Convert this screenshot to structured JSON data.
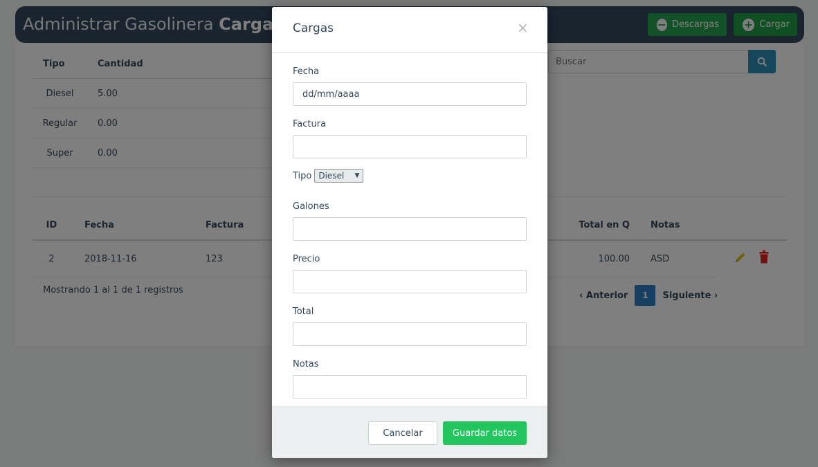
{
  "header": {
    "title_prefix": "Administrar Gasolinera",
    "title_bold": "Cargas",
    "btn_descargas": "Descargas",
    "btn_cargar": "Cargar",
    "color": "#34495e"
  },
  "summary": {
    "headers": [
      "Tipo",
      "Cantidad"
    ],
    "rows": [
      {
        "tipo": "Diesel",
        "cantidad": "5.00"
      },
      {
        "tipo": "Regular",
        "cantidad": "0.00"
      },
      {
        "tipo": "Super",
        "cantidad": "0.00"
      }
    ]
  },
  "search": {
    "placeholder": "Buscar"
  },
  "table": {
    "headers": {
      "id": "ID",
      "fecha": "Fecha",
      "factura": "Factura",
      "total": "Total en Q",
      "notas": "Notas"
    },
    "rows": [
      {
        "id": "2",
        "fecha": "2018-11-16",
        "factura": "123",
        "total": "100.00",
        "notas": "ASD"
      }
    ]
  },
  "records_text": "Mostrando 1 al 1 de 1 registros",
  "pagination": {
    "prev": "‹ Anterior",
    "page": "1",
    "next": "Siguiente ›"
  },
  "modal": {
    "title": "Cargas",
    "close": "×",
    "fecha_label": "Fecha",
    "fecha_value": "dd/mm/aaaa",
    "factura_label": "Factura",
    "factura_value": "",
    "tipo_label": "Tipo",
    "tipo_selected": "Diesel",
    "galones_label": "Galones",
    "galones_value": "",
    "precio_label": "Precio",
    "precio_value": "",
    "total_label": "Total",
    "total_value": "",
    "notas_label": "Notas",
    "notas_value": "",
    "cancel": "Cancelar",
    "save": "Guardar datos"
  }
}
